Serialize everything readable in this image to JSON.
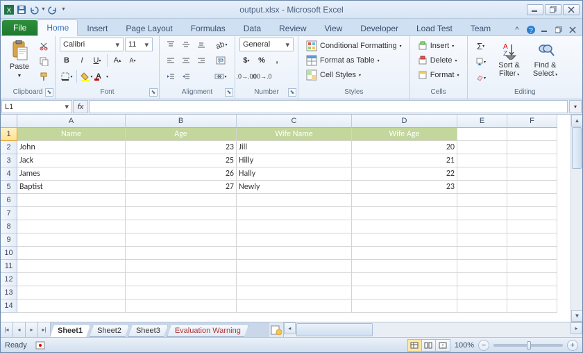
{
  "window": {
    "title": "output.xlsx - Microsoft Excel"
  },
  "qat": {
    "save": "save-icon",
    "undo": "undo-icon",
    "redo": "redo-icon"
  },
  "tabs": {
    "file": "File",
    "items": [
      "Home",
      "Insert",
      "Page Layout",
      "Formulas",
      "Data",
      "Review",
      "View",
      "Developer",
      "Load Test",
      "Team"
    ],
    "active": "Home"
  },
  "ribbon": {
    "clipboard": {
      "label": "Clipboard",
      "paste": "Paste"
    },
    "font": {
      "label": "Font",
      "name": "Calibri",
      "size": "11"
    },
    "alignment": {
      "label": "Alignment"
    },
    "number": {
      "label": "Number",
      "format": "General"
    },
    "styles": {
      "label": "Styles",
      "cond": "Conditional Formatting",
      "table": "Format as Table",
      "cell": "Cell Styles"
    },
    "cells": {
      "label": "Cells",
      "insert": "Insert",
      "delete": "Delete",
      "format": "Format"
    },
    "editing": {
      "label": "Editing",
      "sort": "Sort & Filter",
      "find": "Find & Select"
    }
  },
  "formula_bar": {
    "cell_ref": "L1",
    "value": ""
  },
  "columns": [
    "A",
    "B",
    "C",
    "D",
    "E",
    "F"
  ],
  "header_row": [
    "Name",
    "Age",
    "Wife Name",
    "Wife Age"
  ],
  "data_rows": [
    {
      "a": "John",
      "b": "23",
      "c": "Jill",
      "d": "20"
    },
    {
      "a": "Jack",
      "b": "25",
      "c": "Hilly",
      "d": "21"
    },
    {
      "a": "James",
      "b": "26",
      "c": "Hally",
      "d": "22"
    },
    {
      "a": "Baptist",
      "b": "27",
      "c": "Newly",
      "d": "23"
    }
  ],
  "visible_rows": 14,
  "sheets": {
    "items": [
      "Sheet1",
      "Sheet2",
      "Sheet3",
      "Evaluation Warning"
    ],
    "active": "Sheet1"
  },
  "status": {
    "mode": "Ready",
    "zoom": "100%"
  }
}
